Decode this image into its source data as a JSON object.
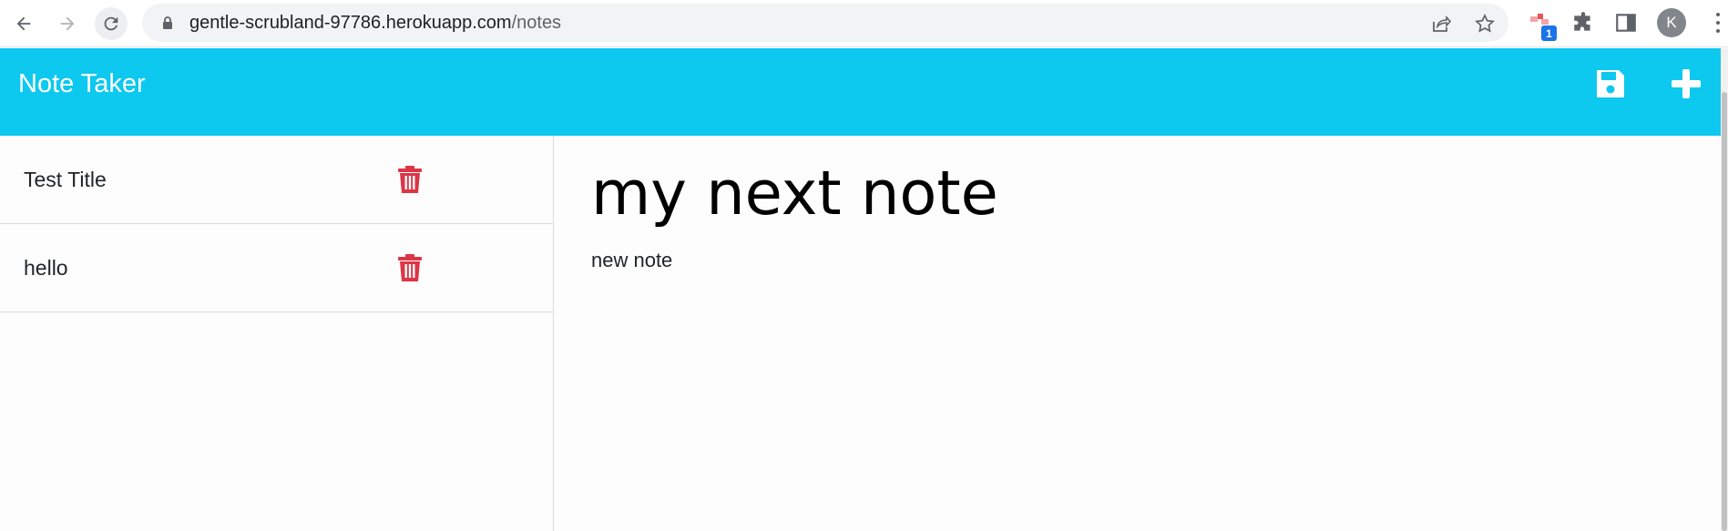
{
  "browser": {
    "url_host": "gentle-scrubland-97786.herokuapp.com",
    "url_path": "/notes",
    "extension_badge": "1",
    "profile_initial": "K"
  },
  "app": {
    "title": "Note Taker",
    "accent_color": "#0dc8ef",
    "delete_color": "#dc3545"
  },
  "notes_list": [
    {
      "title": "Test Title"
    },
    {
      "title": "hello"
    }
  ],
  "active_note": {
    "title": "my next note",
    "text": "new note"
  }
}
